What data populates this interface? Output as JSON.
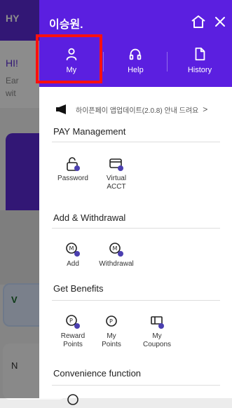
{
  "background": {
    "logo": "HY",
    "greeting": "HI!",
    "sub1": "Ear",
    "sub2": "wit",
    "pill_text": "V",
    "box_text": "N"
  },
  "drawer": {
    "user_name": "이승원.",
    "tabs": [
      {
        "label": "My",
        "icon": "person-icon"
      },
      {
        "label": "Help",
        "icon": "headset-icon"
      },
      {
        "label": "History",
        "icon": "document-icon"
      }
    ],
    "notice": "하이픈페이 앱업데이트(2.0.8) 안내 드려요",
    "sections": [
      {
        "title": "PAY Management",
        "items": [
          {
            "label": "Password",
            "icon": "lock-icon"
          },
          {
            "label": "Virtual ACCT",
            "icon": "card-icon"
          }
        ]
      },
      {
        "title": "Add & Withdrawal",
        "items": [
          {
            "label": "Add",
            "icon": "add-coin-icon"
          },
          {
            "label": "Withdrawal",
            "icon": "withdraw-coin-icon"
          }
        ]
      },
      {
        "title": "Get Benefits",
        "items": [
          {
            "label": "Reward Points",
            "icon": "reward-points-icon"
          },
          {
            "label": "My Points",
            "icon": "points-icon"
          },
          {
            "label": "My Coupons",
            "icon": "coupon-icon"
          }
        ]
      },
      {
        "title": "Convenience function",
        "items": []
      }
    ],
    "colors": {
      "brand": "#5b1fe0",
      "highlight": "#ff1010"
    }
  }
}
